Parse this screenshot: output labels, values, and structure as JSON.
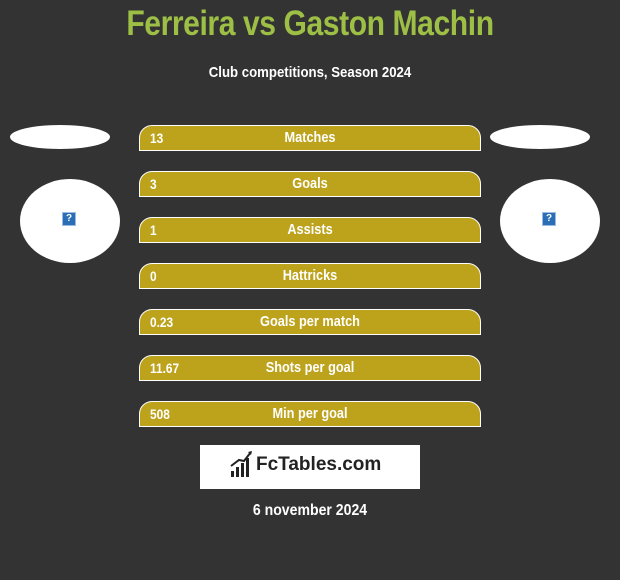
{
  "header": {
    "title": "Ferreira vs Gaston Machin",
    "subtitle": "Club competitions, Season 2024"
  },
  "players": {
    "left": {
      "avatar_icon": "missing-image-icon",
      "avatar_glyph": "?"
    },
    "right": {
      "avatar_icon": "missing-image-icon",
      "avatar_glyph": "?"
    }
  },
  "stats": [
    {
      "value": "13",
      "label": "Matches"
    },
    {
      "value": "3",
      "label": "Goals"
    },
    {
      "value": "1",
      "label": "Assists"
    },
    {
      "value": "0",
      "label": "Hattricks"
    },
    {
      "value": "0.23",
      "label": "Goals per match"
    },
    {
      "value": "11.67",
      "label": "Shots per goal"
    },
    {
      "value": "508",
      "label": "Min per goal"
    }
  ],
  "logo": {
    "text": "FcTables.com",
    "icon": "bar-chart-icon"
  },
  "date": "6 november 2024",
  "colors": {
    "background": "#333333",
    "title": "#9dbf45",
    "bar": "#bda21c",
    "text": "#ffffff"
  }
}
